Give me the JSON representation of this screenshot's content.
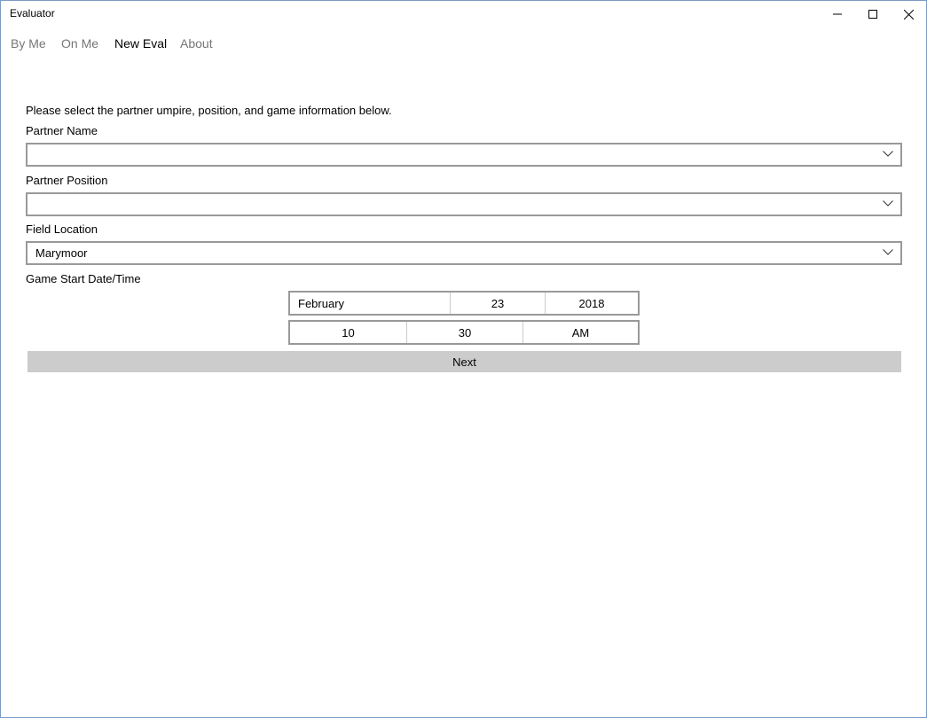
{
  "window": {
    "title": "Evaluator"
  },
  "nav": {
    "items": [
      {
        "label": "By Me"
      },
      {
        "label": "On Me"
      },
      {
        "label": "New Eval"
      },
      {
        "label": "About"
      }
    ],
    "active": "New Eval"
  },
  "form": {
    "instructions": "Please select the partner umpire, position, and game information below.",
    "partner_name": {
      "label": "Partner Name",
      "value": ""
    },
    "partner_position": {
      "label": "Partner Position",
      "value": ""
    },
    "field_location": {
      "label": "Field Location",
      "value": "Marymoor"
    },
    "game_start": {
      "label": "Game Start Date/Time",
      "date": {
        "month": "February",
        "day": "23",
        "year": "2018"
      },
      "time": {
        "hour": "10",
        "minute": "30",
        "period": "AM"
      }
    },
    "next_label": "Next"
  },
  "icons": {
    "minimize": "minimize-icon",
    "maximize": "maximize-icon",
    "close": "close-icon",
    "dropdown": "chevron-down-icon"
  },
  "colors": {
    "border": "#999999",
    "button_bg": "#cccccc",
    "inactive_nav": "#767676"
  }
}
